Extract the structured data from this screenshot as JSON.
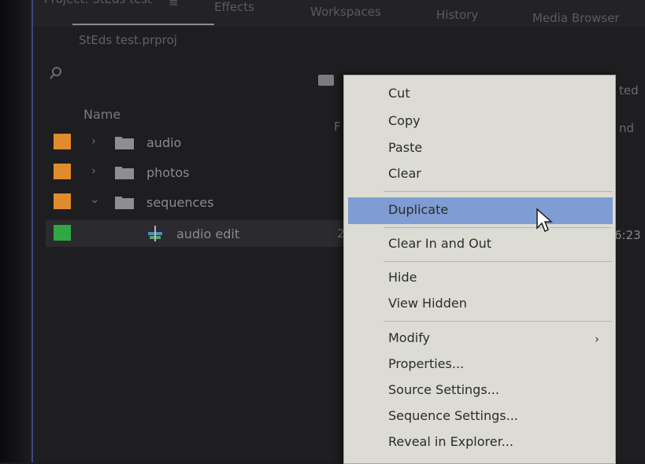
{
  "tabs": {
    "project": "Project: StEds test",
    "project_menu": "≡",
    "effects": "Effects",
    "workspaces": "Workspaces",
    "history": "History",
    "media_browser": "Media Browser"
  },
  "project": {
    "title": "StEds test.prproj",
    "column_name": "Name",
    "column_f": "F",
    "column_right_1": "ted",
    "column_right_2": "nd",
    "items": [
      {
        "label": "audio",
        "chevron": "›",
        "swatch": "#e08b2c"
      },
      {
        "label": "photos",
        "chevron": "›",
        "swatch": "#e08b2c"
      },
      {
        "label": "sequences",
        "chevron": "⌄",
        "swatch": "#e08b2c"
      },
      {
        "label": "audio edit",
        "number": "2",
        "right_value": "6:23",
        "swatch": "#2fa843"
      }
    ]
  },
  "context_menu": {
    "items": [
      "Cut",
      "Copy",
      "Paste",
      "Clear",
      "Duplicate",
      "Clear In and Out",
      "Hide",
      "View Hidden",
      "Modify",
      "Properties...",
      "Source Settings...",
      "Sequence Settings...",
      "Reveal in Explorer..."
    ],
    "highlighted": "Duplicate",
    "submenu_arrow": "›"
  },
  "colors": {
    "highlight": "#7f9dd2",
    "menu_bg": "#dcdcd4",
    "bin_label_orange": "#e08b2c",
    "sequence_label_green": "#2fa843"
  }
}
